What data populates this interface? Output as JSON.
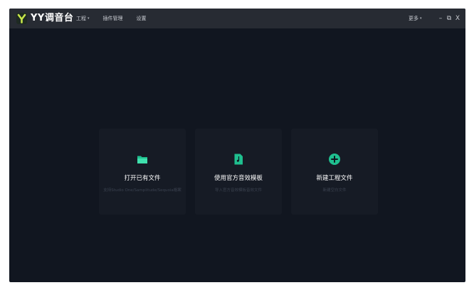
{
  "app": {
    "title": "YY调音台",
    "menu": [
      {
        "label": "工程",
        "has_dropdown": true
      },
      {
        "label": "插件管理",
        "has_dropdown": false
      },
      {
        "label": "设置",
        "has_dropdown": false
      }
    ],
    "more_label": "更多",
    "window_controls": {
      "minimize": "–",
      "restore": "⧉",
      "close": "X"
    },
    "caret": "▾"
  },
  "cards": [
    {
      "title": "打开已有文件",
      "description": "支持Studio One/Samplitude/Sequoia格案",
      "icon": "folder-icon"
    },
    {
      "title": "使用官方音效模板",
      "description": "导入官方音效模板音效文件",
      "icon": "music-file-icon"
    },
    {
      "title": "新建工程文件",
      "description": "新建空白文件",
      "icon": "add-circle-icon"
    }
  ],
  "colors": {
    "accent": "#1fbf8f",
    "window_bg": "#111620",
    "titlebar_bg": "#272b33",
    "card_bg": "#161b25"
  }
}
